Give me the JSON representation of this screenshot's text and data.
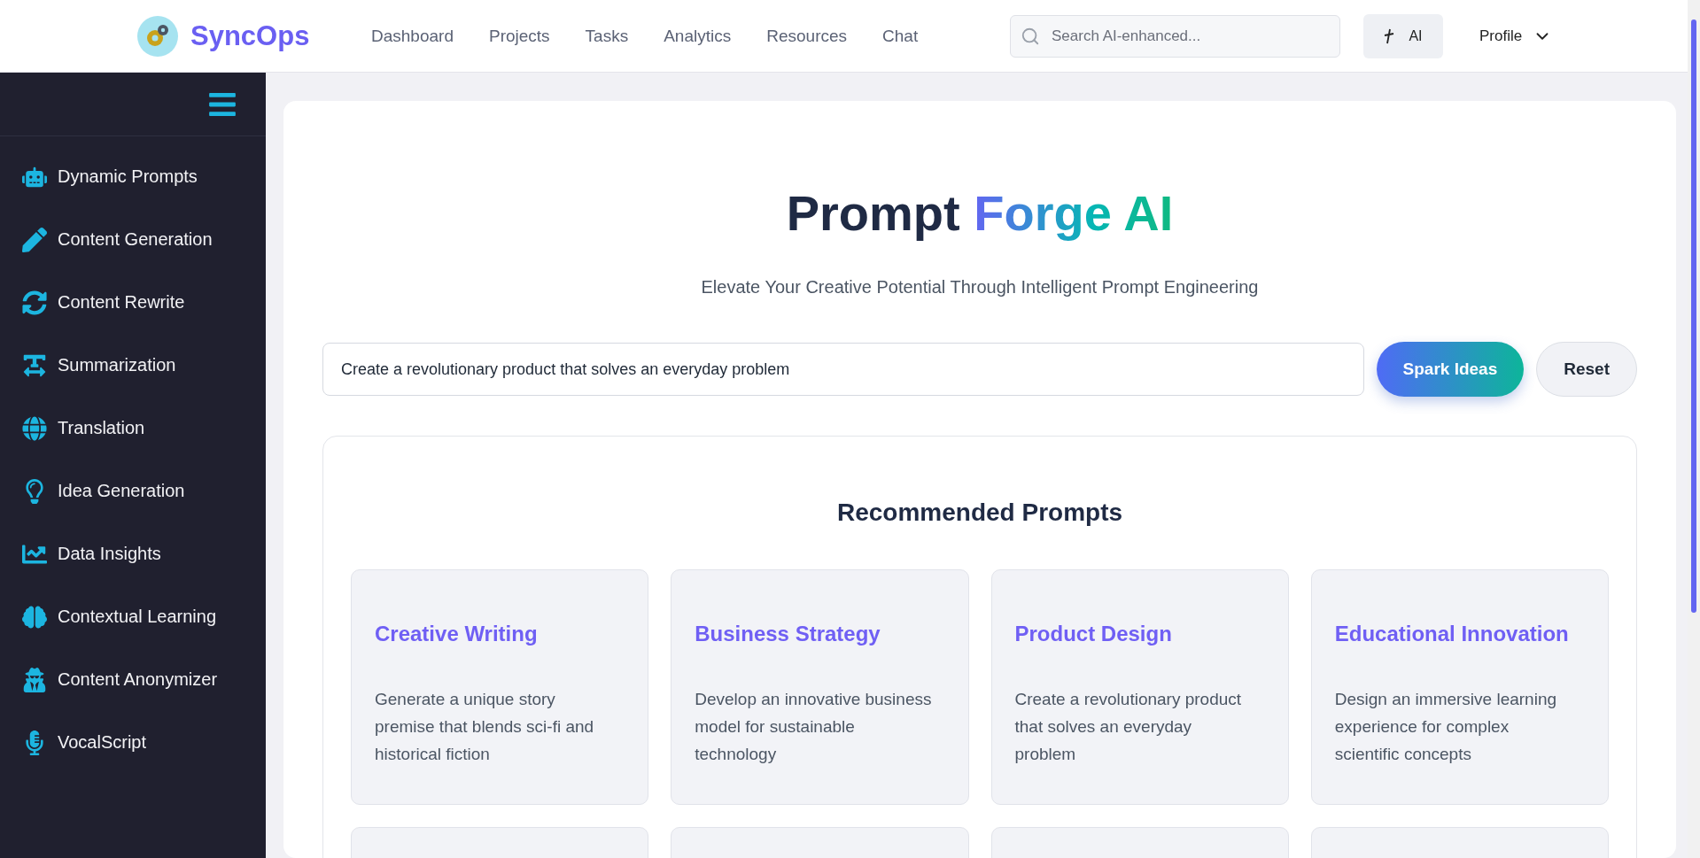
{
  "header": {
    "brand": "SyncOps",
    "nav": [
      {
        "label": "Dashboard"
      },
      {
        "label": "Projects"
      },
      {
        "label": "Tasks"
      },
      {
        "label": "Analytics"
      },
      {
        "label": "Resources"
      },
      {
        "label": "Chat"
      }
    ],
    "search": {
      "placeholder": "Search AI-enhanced..."
    },
    "ai_button": "AI",
    "profile": "Profile"
  },
  "sidebar": {
    "items": [
      {
        "label": "Dynamic Prompts"
      },
      {
        "label": "Content Generation"
      },
      {
        "label": "Content Rewrite"
      },
      {
        "label": "Summarization"
      },
      {
        "label": "Translation"
      },
      {
        "label": "Idea Generation"
      },
      {
        "label": "Data Insights"
      },
      {
        "label": "Contextual Learning"
      },
      {
        "label": "Content Anonymizer"
      },
      {
        "label": "VocalScript"
      }
    ]
  },
  "main": {
    "title": {
      "plain": "Prompt",
      "highlight": "Forge AI"
    },
    "subtitle": "Elevate Your Creative Potential Through Intelligent Prompt Engineering",
    "prompt_input": {
      "value": "Create a revolutionary product that solves an everyday problem"
    },
    "buttons": [
      {
        "label": "Spark Ideas",
        "kind": "primary"
      },
      {
        "label": "Reset",
        "kind": "secondary"
      }
    ],
    "recommended": {
      "heading": "Recommended Prompts",
      "cards": [
        {
          "kind": "prompt",
          "title": "Creative Writing",
          "text": "Generate a unique story premise that blends sci-fi and historical fiction"
        },
        {
          "kind": "prompt",
          "title": "Business Strategy",
          "text": "Develop an innovative business model for sustainable technology"
        },
        {
          "kind": "prompt",
          "title": "Product Design",
          "text": "Create a revolutionary product that solves an everyday problem"
        },
        {
          "kind": "prompt",
          "title": "Educational Innovation",
          "text": "Design an immersive learning experience for complex scientific concepts"
        },
        {
          "kind": "blank"
        },
        {
          "kind": "blank"
        },
        {
          "kind": "blank"
        },
        {
          "kind": "blank"
        }
      ]
    }
  }
}
